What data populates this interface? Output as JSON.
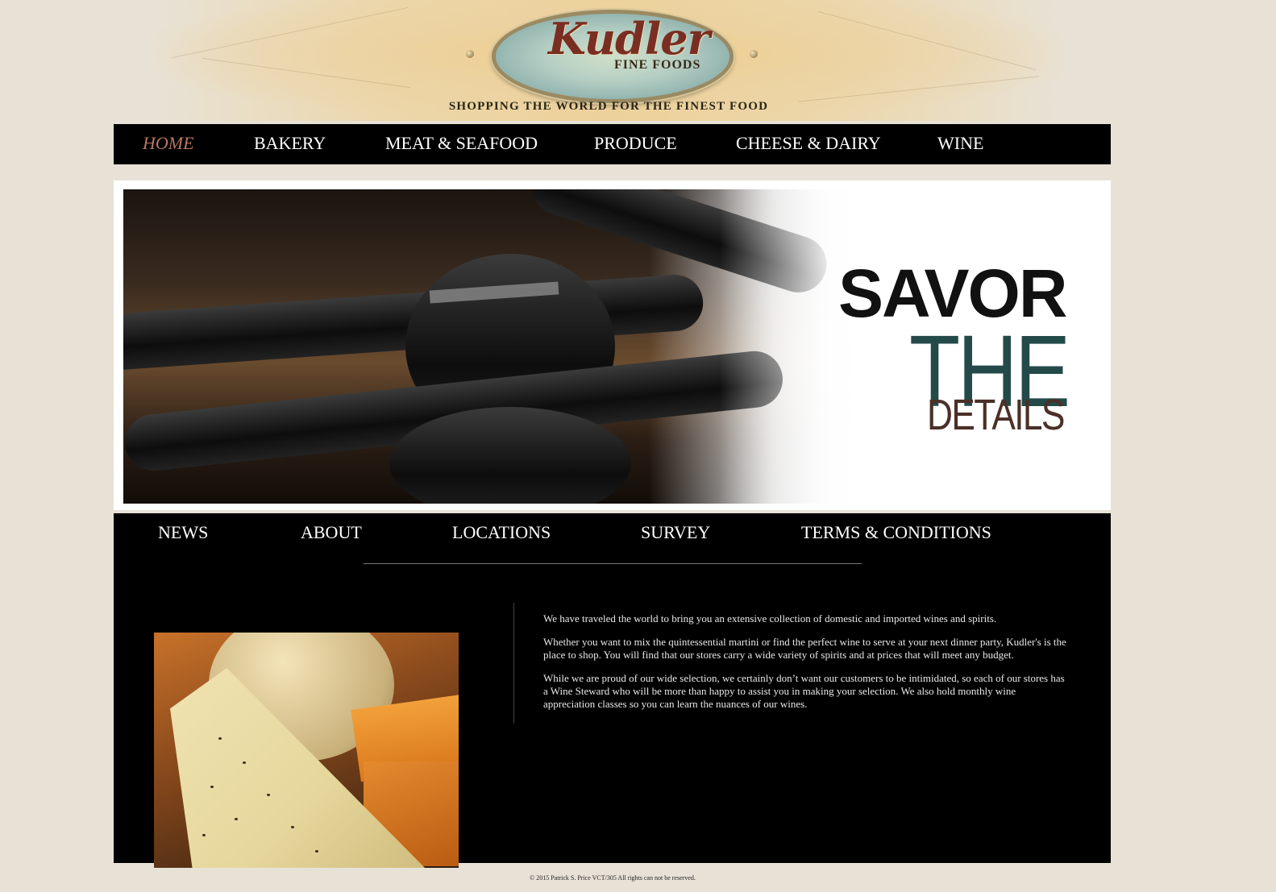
{
  "header": {
    "logo_script": "Kudler",
    "logo_sub": "FINE FOODS",
    "tagline": "SHOPPING THE WORLD FOR THE FINEST FOOD"
  },
  "top_nav": {
    "items": [
      {
        "label": "HOME",
        "active": true
      },
      {
        "label": "BAKERY"
      },
      {
        "label": "MEAT & SEAFOOD"
      },
      {
        "label": "PRODUCE"
      },
      {
        "label": "CHEESE & DAIRY"
      },
      {
        "label": "WINE"
      }
    ]
  },
  "hero": {
    "line1": "SAVOR",
    "line2": "THE",
    "line3": "DETAILS"
  },
  "sub_nav": {
    "items": [
      {
        "label": "NEWS"
      },
      {
        "label": "ABOUT"
      },
      {
        "label": "LOCATIONS"
      },
      {
        "label": "SURVEY"
      },
      {
        "label": "TERMS & CONDITIONS"
      }
    ]
  },
  "body_copy": {
    "paragraphs": [
      "We have traveled the world to bring you an extensive collection of domestic and imported wines and spirits.",
      "Whether you want to mix the quintessential martini or find the perfect wine to serve at your next dinner party, Kudler's is the place to shop. You will find that our stores carry a wide variety of spirits and at prices that will meet any budget.",
      "While we are proud of our wide selection, we certainly don’t want our customers to be intimidated, so each of our stores has a Wine Steward who will be more than happy to assist you in making your selection. We also hold monthly wine appreciation classes so you can learn the nuances of our wines."
    ]
  },
  "footer": {
    "text": "© 2015 Patrick S. Price VCT/305 All rights can not be reserved."
  },
  "colors": {
    "page_bg": "#e8e2d6",
    "nav_bg": "#000000",
    "nav_active": "#b97963",
    "the_accent": "#234a48"
  }
}
